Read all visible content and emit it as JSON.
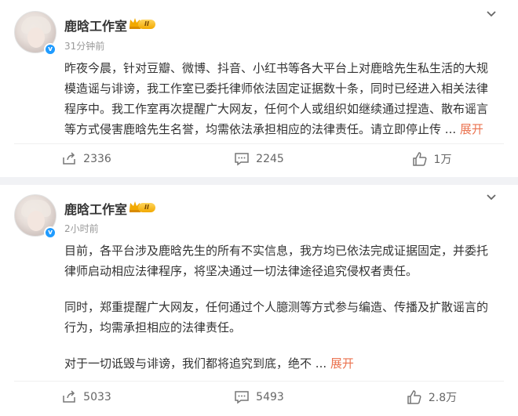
{
  "posts": [
    {
      "author": "鹿晗工作室",
      "level_badge": "II",
      "verified_mark": "v",
      "time": "31分钟前",
      "lines": [
        "昨夜今晨，针对豆瓣、微博、抖音、小红书等各大平台上对鹿晗先生私生活的大规",
        "模造谣与诽谤，我工作室已委托律师依法固定证据数十条，同时已经进入相关法律",
        "程序中。我工作室再次提醒广大网友，任何个人或组织如继续通过捏造、散布谣言",
        "等方式侵害鹿晗先生名誉，均需依法承担相应的法律责任。请立即停止传"
      ],
      "ellipsis": "...",
      "expand_label": "展开",
      "reposts": "2336",
      "comments": "2245",
      "likes": "1万"
    },
    {
      "author": "鹿晗工作室",
      "level_badge": "II",
      "verified_mark": "v",
      "time": "2小时前",
      "para1": [
        "目前，各平台涉及鹿晗先生的所有不实信息，我方均已依法完成证据固定，并委托",
        "律师启动相应法律程序，将坚决通过一切法律途径追究侵权者责任。"
      ],
      "para2": [
        "同时，郑重提醒广大网友，任何通过个人臆测等方式参与编造、传播及扩散谣言的",
        "行为，均需承担相应的法律责任。"
      ],
      "para3": "对于一切诋毁与诽谤，我们都将追究到底，绝不",
      "ellipsis": "...",
      "expand_label": "展开",
      "reposts": "5033",
      "comments": "5493",
      "likes": "2.8万"
    }
  ],
  "icons": {
    "more": "chevron-down-icon",
    "repost": "repost-icon",
    "comment": "comment-icon",
    "like": "thumbs-up-icon"
  },
  "colors": {
    "expand": "#eb7350",
    "verified": "#1f9bff",
    "level_badge": "#f2a900",
    "background": "#f1f2f5"
  }
}
